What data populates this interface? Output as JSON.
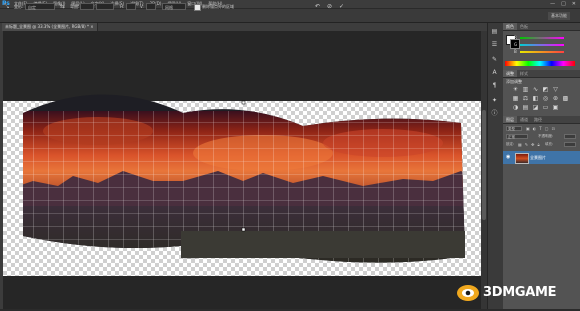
{
  "app": {
    "logo": "Ps"
  },
  "menu": [
    "文件(F)",
    "编辑(E)",
    "图像(I)",
    "图层(L)",
    "文字(Y)",
    "选择(S)",
    "滤镜(T)",
    "3D(D)",
    "视图(V)",
    "窗口(W)",
    "帮助(H)"
  ],
  "window_controls": {
    "minimize": "—",
    "maximize": "□",
    "close": "✕"
  },
  "options": {
    "warp_label": "变形:",
    "warp_value": "自定",
    "bend_label": "弯曲:",
    "h_label": "H:",
    "v_label": "V:",
    "mode_value": "网格",
    "checkbox_label": "删除锚点外的区域"
  },
  "document_tab": {
    "label": "未标题_全景图 @ 33.3% (全景图片, RGB/8) *",
    "close": "×"
  },
  "panels": {
    "color_tabs": [
      "颜色",
      "色板"
    ],
    "color_sliders": [
      {
        "label": "R",
        "colors": [
          "#000000",
          "#ff0000"
        ]
      },
      {
        "label": "G",
        "colors": [
          "#000000",
          "#00ff00"
        ]
      },
      {
        "label": "B",
        "colors": [
          "#000000",
          "#0000ff"
        ]
      }
    ],
    "adjust_tabs": [
      "调整",
      "样式"
    ],
    "adjust_title": "添加调整",
    "layers_tabs": [
      "图层",
      "通道",
      "路径"
    ],
    "kind_label": "类型",
    "blend_mode": "正常",
    "opacity_label": "不透明度:",
    "lock_label": "锁定:",
    "fill_label": "填充:",
    "layer_name": "全景图片",
    "essentials": "基本功能"
  },
  "watermark": {
    "text": "3DMGAME"
  }
}
